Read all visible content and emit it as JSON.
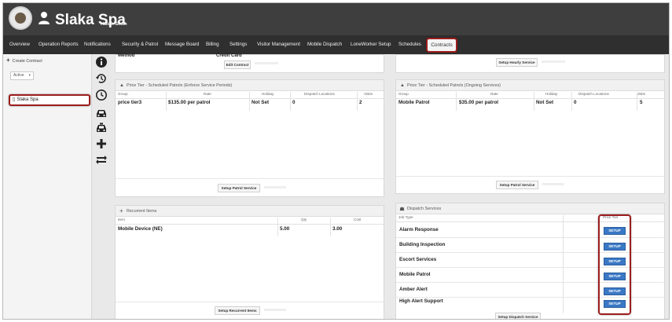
{
  "header": {
    "brand": "Slaka Spa",
    "brand_sub": "Haitan Smith"
  },
  "nav": {
    "items": [
      "Overview",
      "Operation Reports",
      "Notifications",
      "Security & Patrol",
      "Message Board",
      "Billing",
      "Settings",
      "Visitor Management",
      "Mobile Dispatch",
      "LoneWorker Setup",
      "Schedules"
    ],
    "active": "Contracts"
  },
  "sidebar": {
    "create_label": "Create Contract",
    "status_value": "Active",
    "contract_name": "Slaka Spa"
  },
  "icons": [
    "info-icon",
    "history-icon",
    "clock-icon",
    "car-icon",
    "taxi-icon",
    "plus-icon",
    "exchange-icon"
  ],
  "top_left": {
    "method_label": "Method",
    "method_value": "Credit Card",
    "edit_button": "Edit Contract"
  },
  "top_right": {
    "button": "Setup Hourly Service"
  },
  "enforce_panel": {
    "title": "Price Tier - Scheduled Patrols (Enforce Service Periods)",
    "columns": [
      "Group",
      "Rate",
      "Holiday",
      "Dispatch Locations",
      "Visits"
    ],
    "rows": [
      [
        "price tier3",
        "$135.00 per patrol",
        "Not Set",
        "0",
        "2"
      ]
    ],
    "button": "Setup Patrol Service"
  },
  "ongoing_panel": {
    "title": "Price Tier - Scheduled Patrols (Ongoing Services)",
    "columns": [
      "Group",
      "Rate",
      "Holiday",
      "Dispatch Locations",
      "Visits"
    ],
    "rows": [
      [
        "Mobile Patrol",
        "$35.00 per patrol",
        "Not Set",
        "0",
        "5"
      ]
    ],
    "button": "Setup Patrol Service"
  },
  "recurrent_panel": {
    "title": "Recurrent Items",
    "columns": [
      "Item",
      "Qty",
      "Cost"
    ],
    "rows": [
      [
        "Mobile Device (NE)",
        "5.00",
        "3.00"
      ]
    ],
    "button": "Setup Recurrent Items"
  },
  "dispatch_panel": {
    "title": "Dispatch Services",
    "column_left": "Job Type",
    "column_right": "Price Tier",
    "services": [
      "Alarm Response",
      "Building Inspection",
      "Escort Services",
      "Mobile Patrol",
      "Amber Alert",
      "High Alert Support"
    ],
    "setup_label": "SETUP",
    "button": "Setup Dispatch Service"
  },
  "colors": {
    "header": "#3e3e3e",
    "nav": "#2f2f2f",
    "highlight": "#9c1d1d",
    "setup_button": "#3a78c5"
  }
}
